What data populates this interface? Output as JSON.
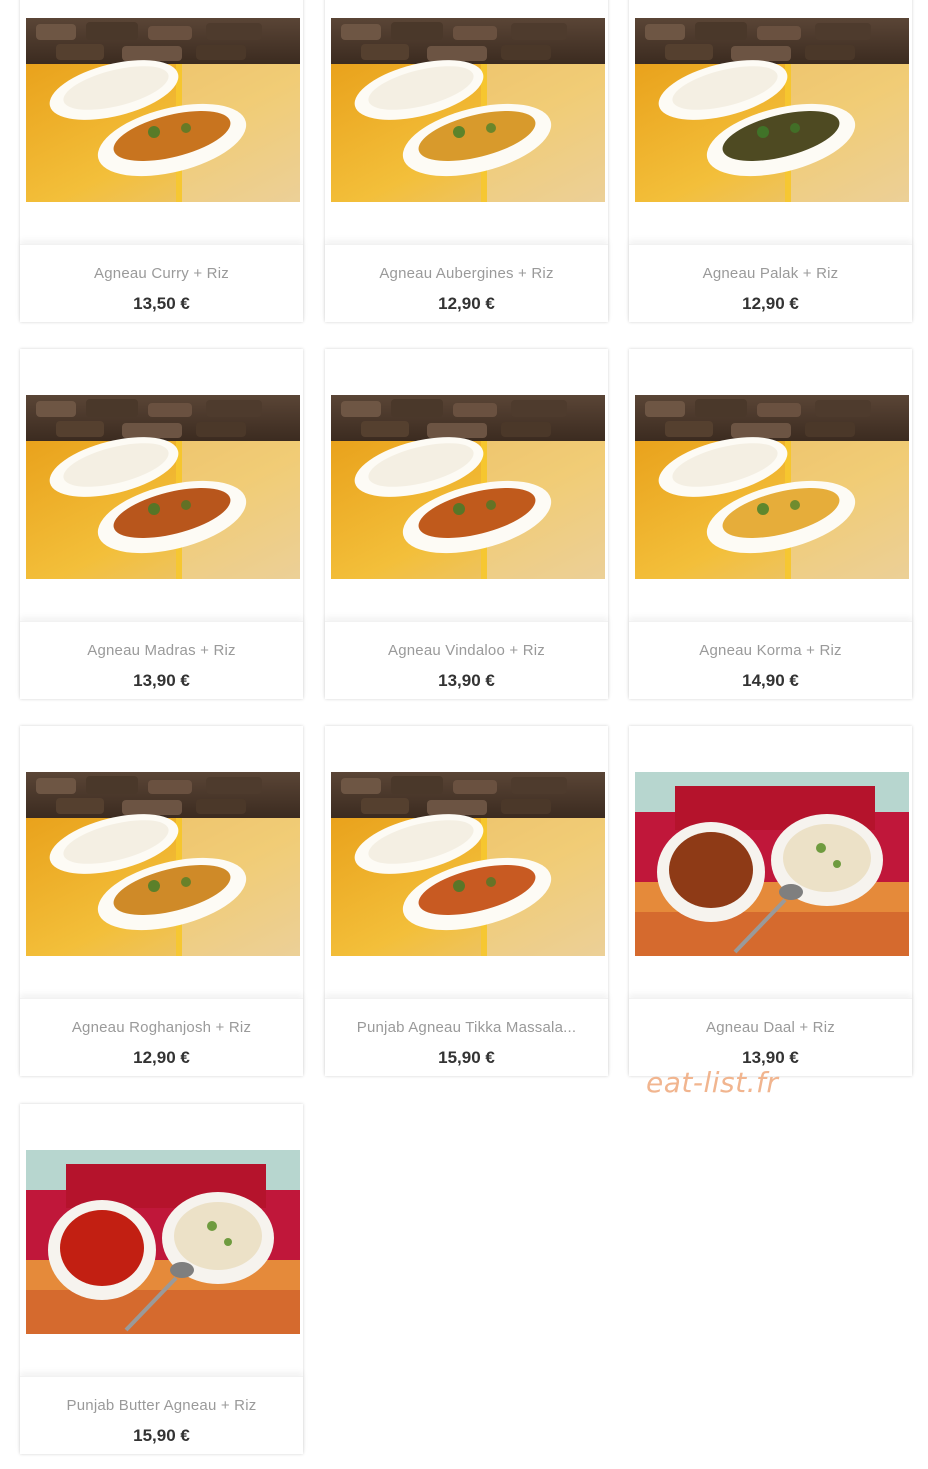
{
  "colors": {
    "name_text": "#9a9a9a",
    "price_text": "#333333",
    "watermark": "#f1b58f"
  },
  "items": [
    {
      "name": "Agneau Curry + Riz",
      "price": "13,50 €",
      "image": "lamb-curry-with-rice-photo",
      "scene": "wood",
      "sauce": "#c8741f"
    },
    {
      "name": "Agneau Aubergines + Riz",
      "price": "12,90 €",
      "image": "lamb-eggplant-with-rice-photo",
      "scene": "wood",
      "sauce": "#d89a2c"
    },
    {
      "name": "Agneau Palak + Riz",
      "price": "12,90 €",
      "image": "lamb-spinach-with-rice-photo",
      "scene": "wood",
      "sauce": "#4e4a22"
    },
    {
      "name": "Agneau Madras + Riz",
      "price": "13,90 €",
      "image": "lamb-madras-with-rice-photo",
      "scene": "wood",
      "sauce": "#b8561c"
    },
    {
      "name": "Agneau Vindaloo + Riz",
      "price": "13,90 €",
      "image": "lamb-vindaloo-with-rice-photo",
      "scene": "wood",
      "sauce": "#c05a1c"
    },
    {
      "name": "Agneau Korma + Riz",
      "price": "14,90 €",
      "image": "lamb-korma-with-rice-photo",
      "scene": "wood",
      "sauce": "#e6ad3a"
    },
    {
      "name": "Agneau Roghanjosh + Riz",
      "price": "12,90 €",
      "image": "lamb-roghanjosh-with-rice-photo",
      "scene": "wood",
      "sauce": "#cf8a28"
    },
    {
      "name": "Punjab Agneau Tikka Massala...",
      "price": "15,90 €",
      "image": "lamb-tikka-masala-with-rice-photo",
      "scene": "wood",
      "sauce": "#c85a22"
    },
    {
      "name": "Agneau Daal + Riz",
      "price": "13,90 €",
      "image": "lamb-daal-with-rice-photo",
      "scene": "cloth",
      "sauce": "#8e3a16"
    },
    {
      "name": "Punjab Butter Agneau + Riz",
      "price": "15,90 €",
      "image": "butter-lamb-with-rice-photo",
      "scene": "cloth",
      "sauce": "#c21f12"
    }
  ],
  "watermark": "eat-list.fr"
}
